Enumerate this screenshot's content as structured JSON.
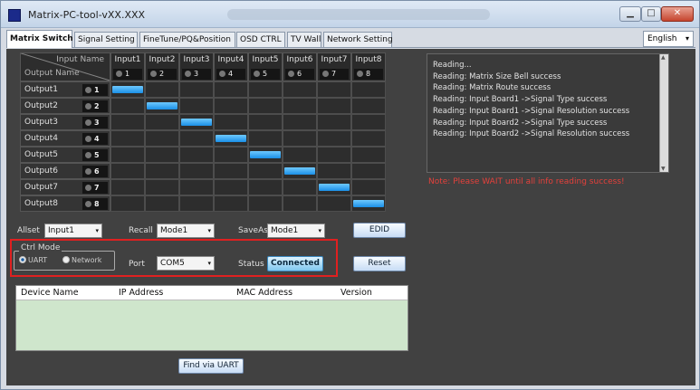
{
  "window": {
    "title": "Matrix-PC-tool-vXX.XXX",
    "minimize": "▁",
    "maximize": "□",
    "close": "✕"
  },
  "tabs": [
    "Matrix Switch",
    "Signal Setting",
    "FineTune/PQ&Position",
    "OSD CTRL",
    "TV Wall",
    "Network Setting"
  ],
  "language": {
    "value": "English",
    "arrow": "▾"
  },
  "grid": {
    "corner_input": "Input Name",
    "corner_output": "Output Name",
    "inputs": [
      {
        "label": "Input1",
        "num": "1"
      },
      {
        "label": "Input2",
        "num": "2"
      },
      {
        "label": "Input3",
        "num": "3"
      },
      {
        "label": "Input4",
        "num": "4"
      },
      {
        "label": "Input5",
        "num": "5"
      },
      {
        "label": "Input6",
        "num": "6"
      },
      {
        "label": "Input7",
        "num": "7"
      },
      {
        "label": "Input8",
        "num": "8"
      }
    ],
    "outputs": [
      {
        "label": "Output1",
        "num": "1",
        "route": 1
      },
      {
        "label": "Output2",
        "num": "2",
        "route": 2
      },
      {
        "label": "Output3",
        "num": "3",
        "route": 3
      },
      {
        "label": "Output4",
        "num": "4",
        "route": 4
      },
      {
        "label": "Output5",
        "num": "5",
        "route": 5
      },
      {
        "label": "Output6",
        "num": "6",
        "route": 6
      },
      {
        "label": "Output7",
        "num": "7",
        "route": 7
      },
      {
        "label": "Output8",
        "num": "8",
        "route": 8
      }
    ]
  },
  "controls": {
    "allset_label": "Allset",
    "allset_value": "Input1",
    "recall_label": "Recall",
    "recall_value": "Mode1",
    "saveas_label": "SaveAs",
    "saveas_value": "Mode1",
    "edid_button": "EDID",
    "ctrl_mode_label": "Ctrl Mode",
    "uart_label": "UART",
    "network_label": "Network",
    "port_label": "Port",
    "port_value": "COM5",
    "status_label": "Status",
    "status_button": "Connected",
    "reset_button": "Reset",
    "dropdown_arrow": "▾"
  },
  "log": {
    "lines": [
      "Reading...",
      "Reading: Matrix Size Bell success",
      "Reading: Matrix Route success",
      "Reading: Input Board1 ->Signal Type success",
      "Reading: Input Board1 ->Signal Resolution success",
      "Reading: Input Board2 ->Signal Type success",
      "Reading: Input Board2 ->Signal Resolution success"
    ],
    "note": "Note: Please WAIT until all info reading success!"
  },
  "devices": {
    "columns": [
      "Device Name",
      "IP Address",
      "MAC Address",
      "Version"
    ],
    "find_button": "Find via UART"
  },
  "colors": {
    "route_on": "#1a8fe6",
    "alert": "#e02020",
    "panel_bg": "#414141"
  }
}
